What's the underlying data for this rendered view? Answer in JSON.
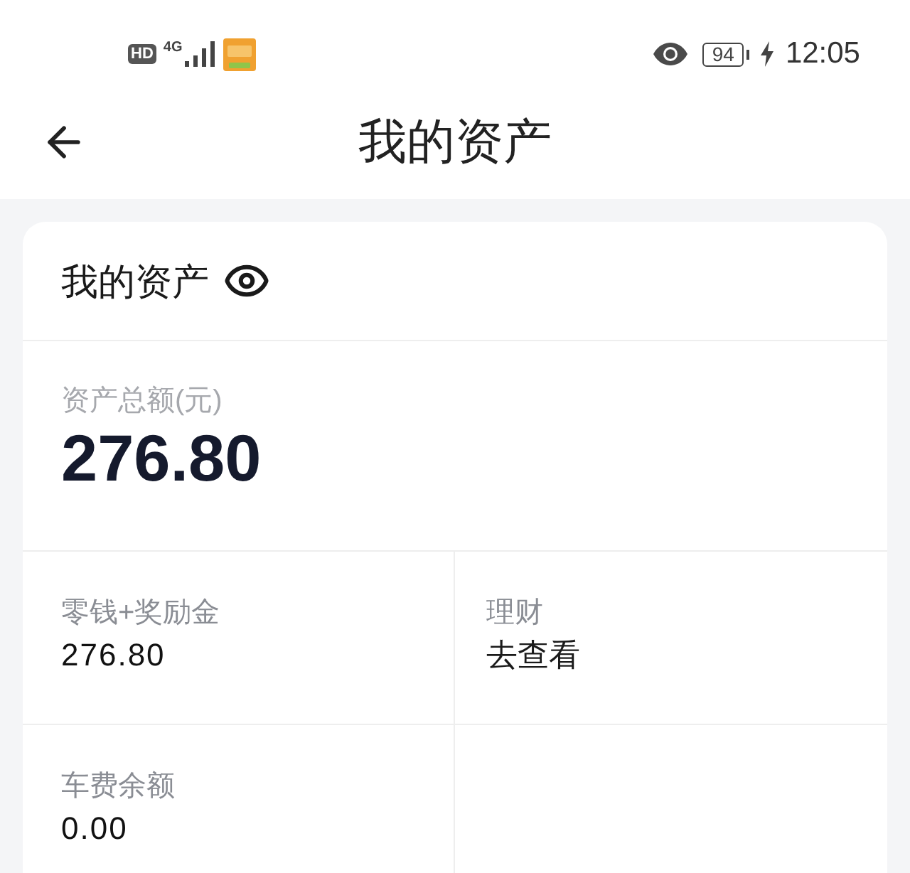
{
  "status_bar": {
    "hd_badge": "HD",
    "network": "4G",
    "battery": "94",
    "charging": true,
    "time": "12:05"
  },
  "nav_bar": {
    "title": "我的资产"
  },
  "assets_card": {
    "title": "我的资产",
    "balance_visible": true,
    "total": {
      "label": "资产总额(元)",
      "amount": "276.80"
    },
    "items": [
      {
        "kind": "amount",
        "label": "零钱+奖励金",
        "value": "276.80"
      },
      {
        "kind": "link",
        "label": "理财",
        "value": "去查看"
      },
      {
        "kind": "amount",
        "label": "车费余额",
        "value": "0.00"
      }
    ]
  }
}
